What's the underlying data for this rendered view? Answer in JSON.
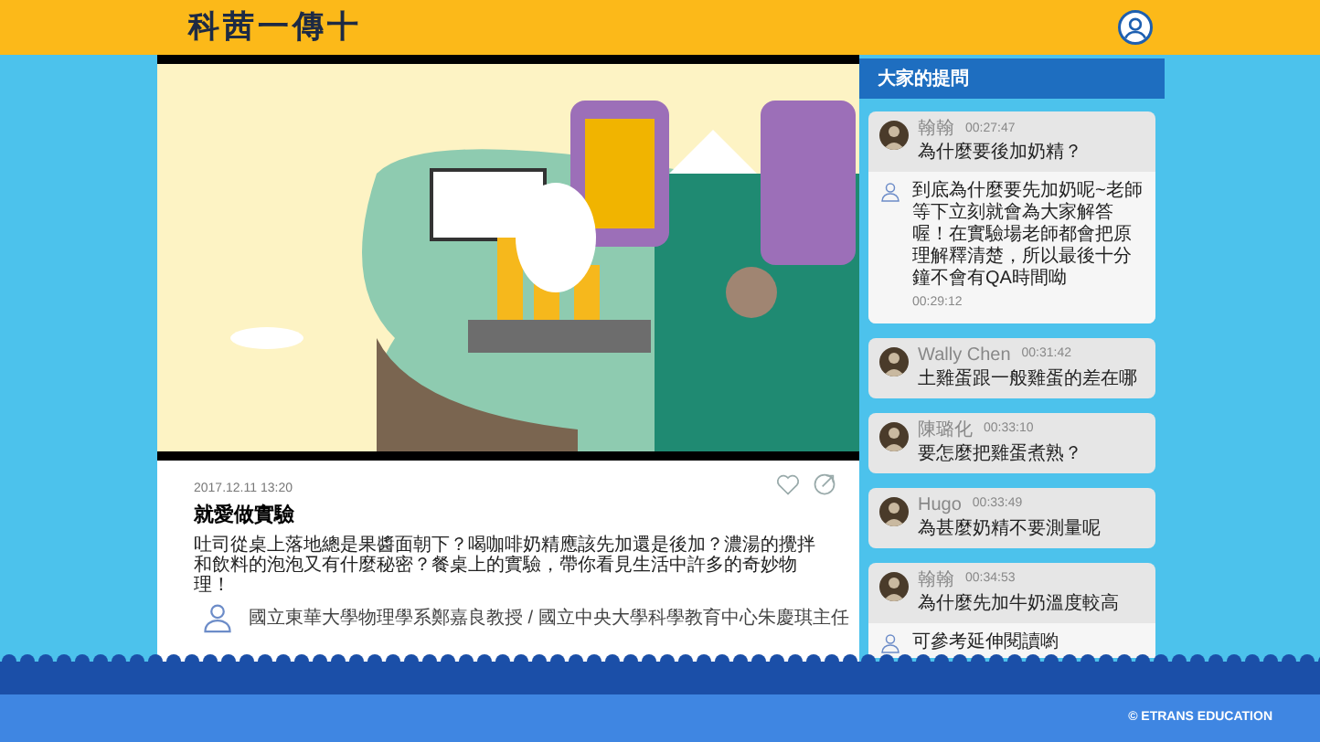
{
  "header": {
    "logo": "科茜一傳十"
  },
  "post": {
    "date": "2017.12.11 13:20",
    "title": "就愛做實驗",
    "description": "吐司從桌上落地總是果醬面朝下？喝咖啡奶精應該先加還是後加？濃湯的攪拌和飲料的泡泡又有什麼秘密？餐桌上的實驗，帶你看見生活中許多的奇妙物理！",
    "speaker": "國立東華大學物理學系鄭嘉良教授 / 國立中央大學科學教育中心朱慶琪主任"
  },
  "sidebar": {
    "title": "大家的提問",
    "questions": [
      {
        "name": "翰翰",
        "time": "00:27:47",
        "text": "為什麼要後加奶精？",
        "answer": {
          "text": "到底為什麼要先加奶呢~老師等下立刻就會為大家解答喔！在實驗場老師都會把原理解釋清楚，所以最後十分鐘不會有QA時間呦",
          "time": "00:29:12"
        }
      },
      {
        "name": "Wally Chen",
        "time": "00:31:42",
        "text": "土雞蛋跟一般雞蛋的差在哪"
      },
      {
        "name": "陳璐化",
        "time": "00:33:10",
        "text": "要怎麼把雞蛋煮熟？"
      },
      {
        "name": "Hugo",
        "time": "00:33:49",
        "text": "為甚麼奶精不要測量呢"
      },
      {
        "name": "翰翰",
        "time": "00:34:53",
        "text": "為什麼先加牛奶溫度較高",
        "answer": {
          "text": "可參考延伸閱讀喲"
        }
      }
    ]
  },
  "footer": {
    "copyright": "© ETRANS EDUCATION"
  }
}
